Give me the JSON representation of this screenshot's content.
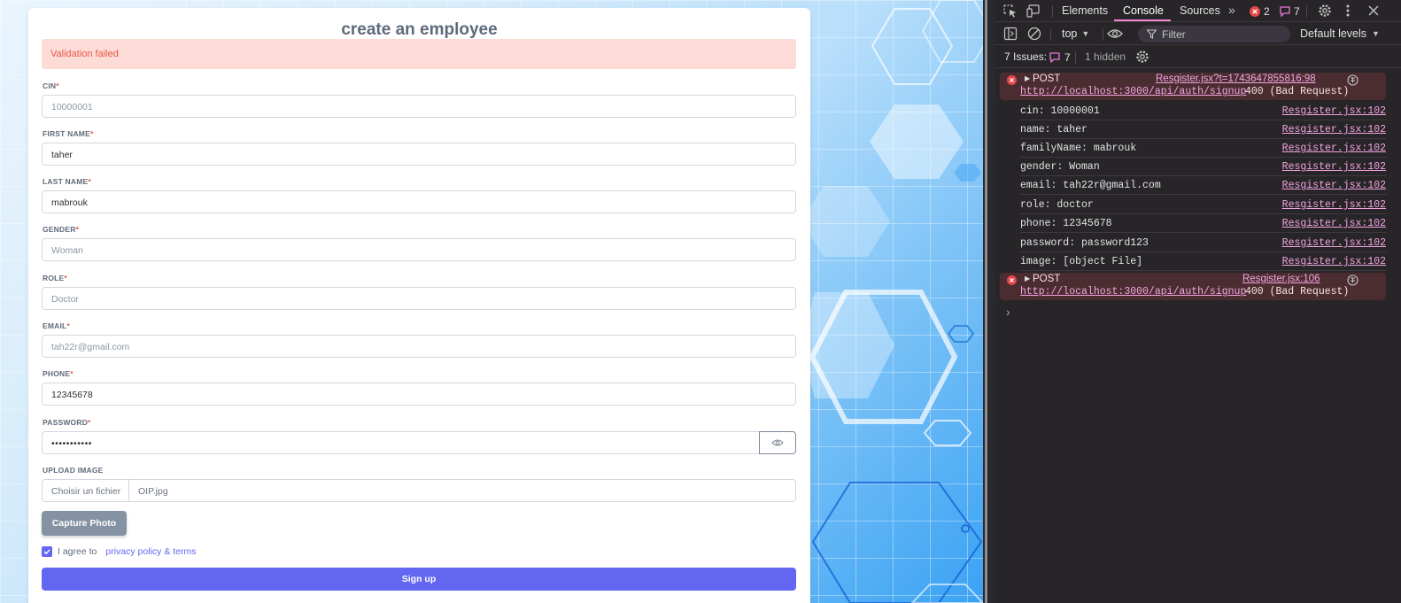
{
  "form": {
    "title": "create an employee",
    "alert": "Validation failed",
    "required_mark": "*",
    "fields": {
      "cin": {
        "label": "CIN",
        "value": "10000001"
      },
      "first_name": {
        "label": "FIRST NAME",
        "value": "taher"
      },
      "last_name": {
        "label": "LAST NAME",
        "value": "mabrouk"
      },
      "gender": {
        "label": "GENDER",
        "value": "Woman"
      },
      "role": {
        "label": "ROLE",
        "value": "Doctor"
      },
      "email": {
        "label": "EMAIL",
        "value": "tah22r@gmail.com"
      },
      "phone": {
        "label": "PHONE",
        "value": "12345678"
      },
      "password": {
        "label": "PASSWORD",
        "value": "•••••••••••"
      }
    },
    "upload": {
      "label": "UPLOAD IMAGE",
      "button": "Choisir un fichier",
      "file_name": "OIP.jpg"
    },
    "capture_button": "Capture Photo",
    "agree_text": "I agree to",
    "agree_link": "privacy policy & terms",
    "signup_button": "Sign up"
  },
  "devtools": {
    "tabs": {
      "elements": "Elements",
      "console": "Console",
      "sources": "Sources"
    },
    "error_count": "2",
    "message_count": "7",
    "toolbar": {
      "context": "top",
      "filter_placeholder": "Filter",
      "levels": "Default levels"
    },
    "issues": {
      "label": "7 Issues:",
      "count": "7",
      "hidden": "1 hidden"
    },
    "errors": [
      {
        "method": "POST",
        "source": "Resgister.jsx?t=1743647855816:98",
        "url": "http://localhost:3000/api/auth/signup",
        "status": "400 (Bad Request)"
      },
      {
        "method": "POST",
        "source": "Resgister.jsx:106",
        "url": "http://localhost:3000/api/auth/signup",
        "status": "400 (Bad Request)"
      }
    ],
    "logs": [
      {
        "text": "cin: 10000001",
        "source": "Resgister.jsx:102"
      },
      {
        "text": "name: taher",
        "source": "Resgister.jsx:102"
      },
      {
        "text": "familyName: mabrouk",
        "source": "Resgister.jsx:102"
      },
      {
        "text": "gender: Woman",
        "source": "Resgister.jsx:102"
      },
      {
        "text": "email: tah22r@gmail.com",
        "source": "Resgister.jsx:102"
      },
      {
        "text": "role: doctor",
        "source": "Resgister.jsx:102"
      },
      {
        "text": "phone: 12345678",
        "source": "Resgister.jsx:102"
      },
      {
        "text": "password: password123",
        "source": "Resgister.jsx:102"
      },
      {
        "text": "image: [object File]",
        "source": "Resgister.jsx:102"
      }
    ],
    "prompt": "›"
  },
  "colors": {
    "accent": "#6366f1",
    "alert_bg": "#fddcd8",
    "alert_text": "#e8584a",
    "devtools_bg": "#282529",
    "error_row_bg": "#4b2d31",
    "link_pink": "#f2a5df"
  }
}
